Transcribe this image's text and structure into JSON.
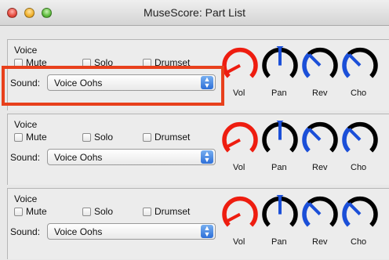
{
  "window": {
    "title": "MuseScore: Part List"
  },
  "parts": [
    {
      "name": "Voice",
      "mute_label": "Mute",
      "solo_label": "Solo",
      "drumset_label": "Drumset",
      "sound_label": "Sound:",
      "sound_value": "Voice Oohs",
      "knobs": {
        "vol": "Vol",
        "pan": "Pan",
        "rev": "Rev",
        "cho": "Cho"
      }
    },
    {
      "name": "Voice",
      "mute_label": "Mute",
      "solo_label": "Solo",
      "drumset_label": "Drumset",
      "sound_label": "Sound:",
      "sound_value": "Voice Oohs",
      "knobs": {
        "vol": "Vol",
        "pan": "Pan",
        "rev": "Rev",
        "cho": "Cho"
      }
    },
    {
      "name": "Voice",
      "mute_label": "Mute",
      "solo_label": "Solo",
      "drumset_label": "Drumset",
      "sound_label": "Sound:",
      "sound_value": "Voice Oohs",
      "knobs": {
        "vol": "Vol",
        "pan": "Pan",
        "rev": "Rev",
        "cho": "Cho"
      }
    }
  ],
  "colors": {
    "vol_knob": "#ee1d10",
    "pan_knob_indicator": "#1b4fd8",
    "rev_cho_knob": "#1b4fd8",
    "knob_track": "#000000",
    "highlight_box": "#e8401c"
  }
}
